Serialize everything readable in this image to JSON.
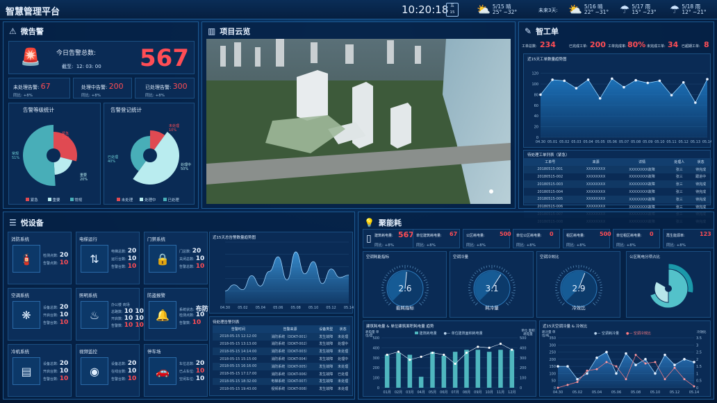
{
  "header": {
    "title": "智慧管理平台",
    "time": "10:20:18",
    "weekday": "五",
    "date_day": "15",
    "today": {
      "icon": "partly-cloudy-icon",
      "date": "5/15 晴",
      "temp": "25° ~32°"
    },
    "forecast_label": "未来3天:",
    "forecast": [
      {
        "icon": "partly-cloudy-icon",
        "date": "5/16 晴",
        "temp": "22° ~31°"
      },
      {
        "icon": "rain-icon",
        "date": "5/17 雨",
        "temp": "15° ~23°"
      },
      {
        "icon": "rain-icon",
        "date": "5/18 雨",
        "temp": "12° ~21°"
      }
    ]
  },
  "alarm": {
    "title": "微告警",
    "today_label": "今日告警总数:",
    "today_value": "567",
    "as_of_label": "截至:",
    "as_of_time": "12: 03: 00",
    "stats": [
      {
        "label": "未处理告警:",
        "value": "67",
        "yoy": "同比: +8%"
      },
      {
        "label": "处理中告警:",
        "value": "200",
        "yoy": "同比: +8%"
      },
      {
        "label": "已处理告警:",
        "value": "300",
        "yoy": "同比: +8%"
      }
    ],
    "level_title": "告警等级统计",
    "level_legend": [
      "紧急",
      "重要",
      "常规"
    ],
    "level_labels": {
      "urgent": "紧急",
      "urgent_pct": "29%",
      "normal": "常规",
      "normal_pct": "51%",
      "important": "重要",
      "important_pct": "20%"
    },
    "reg_title": "告警登记统计",
    "reg_legend": [
      "未处理",
      "处理中",
      "已处理"
    ],
    "reg_labels": {
      "a": "未处理",
      "a_pct": "10%",
      "b": "已处理",
      "b_pct": "40%",
      "c": "处理中",
      "c_pct": "50%"
    }
  },
  "project": {
    "title": "项目云览"
  },
  "workorder": {
    "title": "智工单",
    "stats": [
      {
        "label": "工单总数:",
        "value": "234"
      },
      {
        "label": "已完成工单:",
        "value": "200"
      },
      {
        "label": "工单完成率:",
        "value": "80%"
      },
      {
        "label": "未完成工单:",
        "value": "34"
      },
      {
        "label": "已超期工单:",
        "value": "8"
      }
    ],
    "trend_title": "近15天工单数量趋势图",
    "table_title": "待处理工单列表（紧急）",
    "columns": [
      "工单号",
      "来源",
      "详情",
      "处理人",
      "状态"
    ],
    "rows": [
      [
        "20180515-001",
        "XXXXXXXX",
        "XXXXXXXX故障",
        "张三",
        "待完成"
      ],
      [
        "20180515-002",
        "XXXXXXXX",
        "XXXXXXXX故障",
        "张三",
        "跟进中"
      ],
      [
        "20180515-003",
        "XXXXXXXX",
        "XXXXXXXX故障",
        "张三",
        "待完成"
      ],
      [
        "20180515-004",
        "XXXXXXXX",
        "XXXXXXXX故障",
        "张三",
        "待完成"
      ],
      [
        "20180515-005",
        "XXXXXXXX",
        "XXXXXXXX故障",
        "张三",
        "待完成"
      ],
      [
        "20180515-006",
        "XXXXXXXX",
        "XXXXXXXX故障",
        "张三",
        "待完成"
      ],
      [
        "20180515-007",
        "XXXXXXXX",
        "XXXXXXXX故障",
        "张三",
        "待完成"
      ],
      [
        "20180515-008",
        "XXXXXXXX",
        "XXXXXXXX故障",
        "张三",
        "待完成"
      ]
    ]
  },
  "device": {
    "title": "悦设备",
    "cards": [
      {
        "name": "消防系统",
        "icon": "extinguisher-icon",
        "rows": [
          {
            "k": "检测点数:",
            "v": "20",
            "red": false
          },
          {
            "k": "告警点数:",
            "v": "10",
            "red": true
          }
        ]
      },
      {
        "name": "电梯运行",
        "icon": "elevator-icon",
        "rows": [
          {
            "k": "电梯总数:",
            "v": "20",
            "red": false
          },
          {
            "k": "运行台数:",
            "v": "10",
            "red": false
          },
          {
            "k": "告警台数:",
            "v": "10",
            "red": true
          }
        ]
      },
      {
        "name": "门禁系统",
        "icon": "lock-icon",
        "rows": [
          {
            "k": "门总数:",
            "v": "20",
            "red": false
          },
          {
            "k": "关闭总数:",
            "v": "10",
            "red": false
          },
          {
            "k": "告警总数:",
            "v": "10",
            "red": true
          }
        ]
      },
      {
        "name": "空调系统",
        "icon": "fan-icon",
        "rows": [
          {
            "k": "设备总数:",
            "v": "20",
            "red": false
          },
          {
            "k": "开启台数:",
            "v": "10",
            "red": false
          },
          {
            "k": "告警台数:",
            "v": "10",
            "red": true
          }
        ]
      },
      {
        "name": "照明系统",
        "icon": "lamp-icon",
        "rows": [
          {
            "k": "办公楼 商场",
            "v": "",
            "red": false
          },
          {
            "k": "总路数:",
            "v": "10  10",
            "red": false
          },
          {
            "k": "开启数:",
            "v": "10  10",
            "red": false
          },
          {
            "k": "告警数:",
            "v": "10  10",
            "red": true
          }
        ]
      },
      {
        "name": "防盗报警",
        "icon": "bell-icon",
        "rows": [
          {
            "k": "系统状态:",
            "v": "布防",
            "red": false
          },
          {
            "k": "检测点数:",
            "v": "10",
            "red": false
          },
          {
            "k": "告警数:",
            "v": "10",
            "red": true
          }
        ]
      },
      {
        "name": "冷机系统",
        "icon": "cooler-icon",
        "rows": [
          {
            "k": "设备总数:",
            "v": "20",
            "red": false
          },
          {
            "k": "开启台数:",
            "v": "10",
            "red": false
          },
          {
            "k": "告警台数:",
            "v": "10",
            "red": true
          }
        ]
      },
      {
        "name": "视频监控",
        "icon": "camera-icon",
        "rows": [
          {
            "k": "设备总数:",
            "v": "20",
            "red": false
          },
          {
            "k": "在线台数:",
            "v": "10",
            "red": false
          },
          {
            "k": "告警台数:",
            "v": "10",
            "red": true
          }
        ]
      },
      {
        "name": "停车场",
        "icon": "car-icon",
        "rows": [
          {
            "k": "车位总数:",
            "v": "20",
            "red": false
          },
          {
            "k": "已占车位:",
            "v": "10",
            "red": true
          },
          {
            "k": "空闲车位:",
            "v": "10",
            "red": false
          }
        ]
      }
    ],
    "trend_title": "近15天总告警数量趋势图",
    "list_title": "待处理告警列表",
    "columns": [
      "告警时间",
      "告警来源",
      "设备类型",
      "状态"
    ],
    "rows": [
      [
        "2018-05-15  12:12:00",
        "消防系统（DDKT-001）",
        "发生故障",
        "未处理"
      ],
      [
        "2018-05-15  13:13:00",
        "消防系统（DDKT-002）",
        "发生故障",
        "处理中"
      ],
      [
        "2018-05-15  14:14:00",
        "消防系统（DDKT-003）",
        "发生故障",
        "未处理"
      ],
      [
        "2018-05-15  15:15:00",
        "消防系统（DDKT-004）",
        "发生故障",
        "处理中"
      ],
      [
        "2018-05-15  16:16:00",
        "消防系统（DDKT-005）",
        "发生故障",
        "未处理"
      ],
      [
        "2018-05-15  17:17:00",
        "消防系统（DDKT-006）",
        "发生故障",
        "已处理"
      ],
      [
        "2018-05-15  18:32:00",
        "电梯系统（DDKT-007）",
        "发生故障",
        "未处理"
      ],
      [
        "2018-05-15  19:43:00",
        "视频系统（DDKT-008）",
        "发生故障",
        "未处理"
      ]
    ]
  },
  "energy": {
    "title": "聚能耗",
    "stats": [
      {
        "label": "建筑耗电量:",
        "value": "567",
        "yoy": "同比: +8%",
        "big": true
      },
      {
        "label": "单位建筑耗电量:",
        "value": "67",
        "yoy": "同比: +8%"
      },
      {
        "label": "公区耗电量:",
        "value": "500",
        "yoy": "同比: +8%"
      },
      {
        "label": "单位公区耗电量:",
        "value": "0",
        "yoy": "同比: +8%"
      },
      {
        "label": "租区耗电量:",
        "value": "500",
        "yoy": "同比: +8%"
      },
      {
        "label": "单位租区耗电量:",
        "value": "0",
        "yoy": "同比: +8%"
      },
      {
        "label": "再生能源率:",
        "value": "123",
        "yoy": "同比: +8%"
      }
    ],
    "gauges": [
      {
        "title": "空调耗能指标",
        "value": "2.6",
        "caption": "能耗指标"
      },
      {
        "title": "空调冷量",
        "value": "3.1",
        "caption": "耗冷量"
      },
      {
        "title": "空调冷效比",
        "value": "2.9",
        "caption": "冷效比"
      }
    ],
    "pie_title": "公区耗电分项占比",
    "bar_title": "建筑耗电量 & 单位建筑面积耗电量 趋势",
    "bar_legend": [
      "建筑耗电量",
      "单位建筑面积耗电量"
    ],
    "bar_ylabel_left": "耗电量 单位/度",
    "bar_ylabel_right": "单位 面积耗电量",
    "ac_title": "近15天空调冷量 & 冷效比",
    "ac_legend": [
      "空调耗冷量",
      "空调冷效比"
    ],
    "ac_ylabel_left": "耗冷量 单位/吨",
    "ac_ylabel_right": "冷效比"
  },
  "chart_data": [
    {
      "id": "wo-trend",
      "type": "area",
      "x": [
        "04.30",
        "05.01",
        "05.02",
        "05.03",
        "05.04",
        "05.05",
        "05.06",
        "05.07",
        "05.08",
        "05.09",
        "05.10",
        "05.11",
        "05.12",
        "05.13",
        "05.14"
      ],
      "values": [
        80,
        108,
        106,
        92,
        108,
        73,
        110,
        94,
        107,
        102,
        106,
        79,
        103,
        65,
        109
      ],
      "ylim": [
        0,
        130
      ],
      "yticks": [
        0,
        20,
        40,
        60,
        80,
        100,
        120
      ]
    },
    {
      "id": "alarm-trend",
      "type": "area",
      "x": [
        "04.30",
        "05.02",
        "05.04",
        "05.06",
        "05.08",
        "05.10",
        "05.12",
        "05.14"
      ],
      "values": [
        20,
        30,
        22,
        45,
        28,
        52,
        76,
        38,
        84,
        48,
        68,
        32,
        56,
        42,
        46
      ],
      "ylim": [
        0,
        100
      ],
      "yticks": [
        0,
        20,
        40,
        60,
        80,
        100
      ]
    },
    {
      "id": "power-trend",
      "type": "bar",
      "x": [
        "01月",
        "02月",
        "03月",
        "04月",
        "05月",
        "06月",
        "07月",
        "08月",
        "09月",
        "10月",
        "11月",
        "12月"
      ],
      "values": [
        330,
        350,
        330,
        110,
        360,
        320,
        360,
        380,
        380,
        360,
        380,
        380
      ],
      "line": [
        330,
        360,
        280,
        310,
        350,
        330,
        240,
        350,
        410,
        400,
        440,
        380
      ],
      "ylim": [
        0,
        500
      ],
      "yticks": [
        0,
        100,
        200,
        300,
        400,
        500
      ],
      "y2ticks": [
        0,
        100,
        200,
        300,
        400,
        500
      ]
    },
    {
      "id": "ac-trend",
      "type": "area",
      "x": [
        "04.30",
        "05.02",
        "05.04",
        "05.06",
        "05.08",
        "05.10",
        "05.12",
        "05.14"
      ],
      "values": [
        150,
        150,
        60,
        100,
        210,
        250,
        100,
        240,
        160,
        200,
        100,
        230,
        160,
        200,
        180
      ],
      "line": [
        0,
        20,
        40,
        120,
        130,
        180,
        150,
        60,
        230,
        170,
        180,
        60,
        140,
        60,
        10
      ],
      "ylim": [
        0,
        350
      ],
      "yticks": [
        0,
        50,
        100,
        150,
        200,
        250,
        300,
        350
      ],
      "y2ticks": [
        0.0,
        0.5,
        1.0,
        1.5,
        2.0,
        2.5,
        3.0,
        3.5
      ]
    },
    {
      "id": "alarm-level",
      "type": "pie",
      "labels": [
        "紧急",
        "重要",
        "常规"
      ],
      "values": [
        29,
        20,
        51
      ]
    },
    {
      "id": "alarm-reg",
      "type": "pie",
      "labels": [
        "未处理",
        "处理中",
        "已处理"
      ],
      "values": [
        10,
        50,
        40
      ]
    }
  ]
}
